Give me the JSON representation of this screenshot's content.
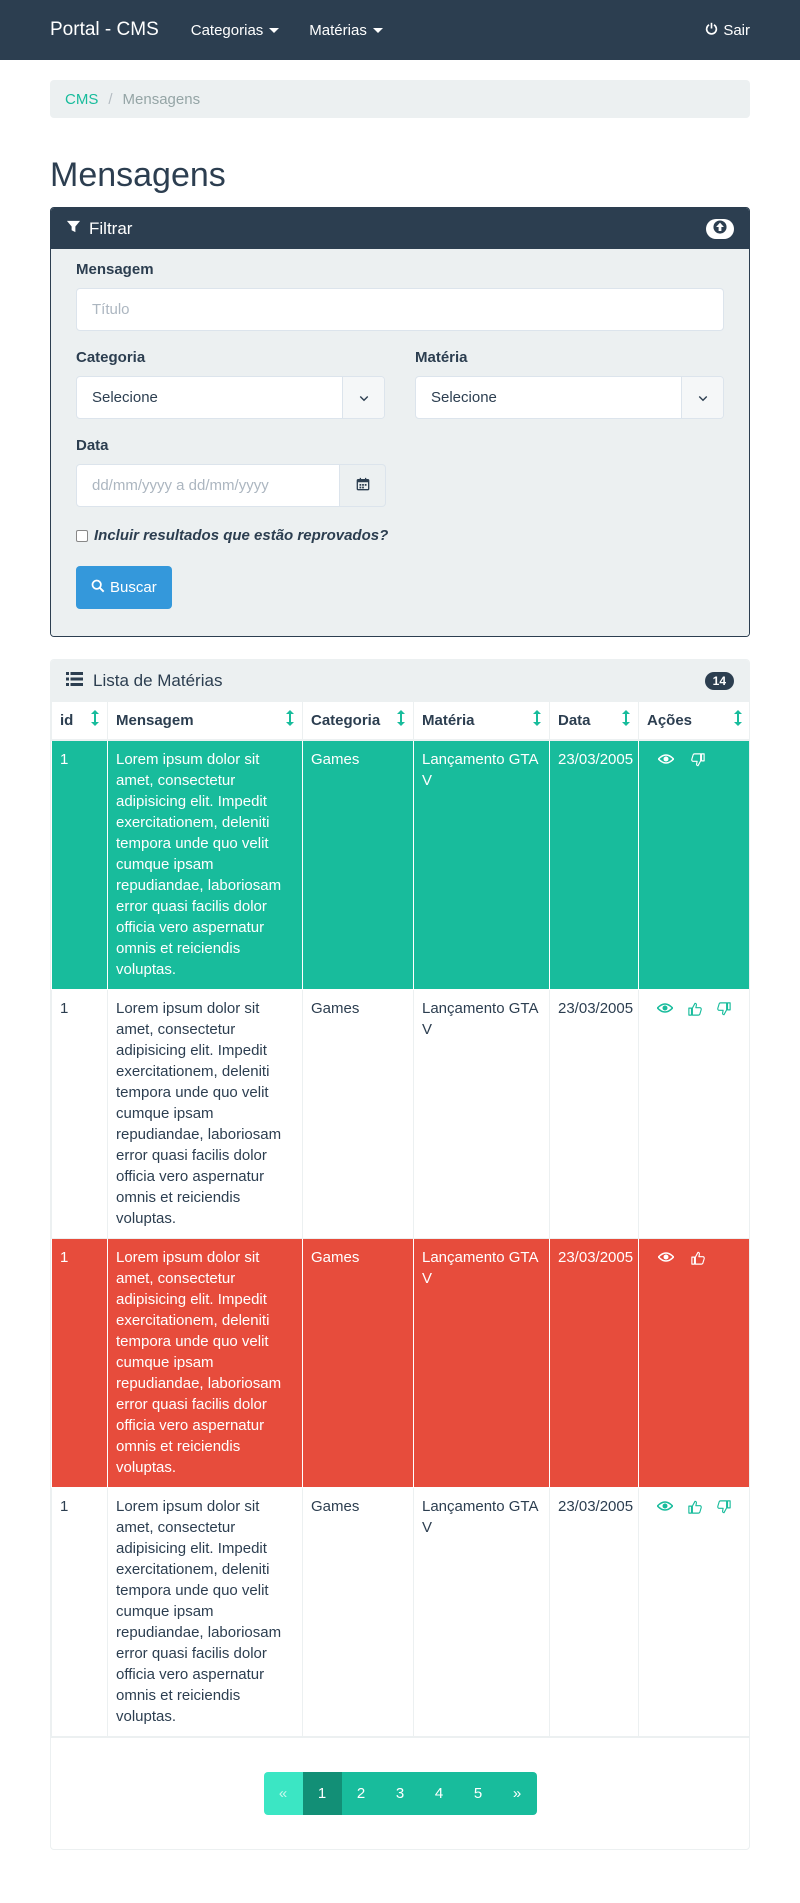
{
  "navbar": {
    "brand": "Portal - CMS",
    "menu": [
      {
        "label": "Categorias"
      },
      {
        "label": "Matérias"
      }
    ],
    "logout_label": "Sair"
  },
  "breadcrumb": {
    "root": "CMS",
    "current": "Mensagens"
  },
  "page_title": "Mensagens",
  "filter": {
    "title": "Filtrar",
    "mensagem_label": "Mensagem",
    "mensagem_placeholder": "Título",
    "categoria_label": "Categoria",
    "categoria_value": "Selecione",
    "materia_label": "Matéria",
    "materia_value": "Selecione",
    "data_label": "Data",
    "data_placeholder": "dd/mm/yyyy a dd/mm/yyyy",
    "reprovados_label": "Incluir resultados que estão reprovados?",
    "search_label": "Buscar"
  },
  "list": {
    "title": "Lista de Matérias",
    "count": "14",
    "columns": [
      "id",
      "Mensagem",
      "Categoria",
      "Matéria",
      "Data",
      "Ações"
    ],
    "rows": [
      {
        "status": "success",
        "id": "1",
        "mensagem": "Lorem ipsum dolor sit amet, consectetur adipisicing elit. Impedit exercitationem, deleniti tempora unde quo velit cumque ipsam repudiandae, laboriosam error quasi facilis dolor officia vero aspernatur omnis et reiciendis voluptas.",
        "categoria": "Games",
        "materia": "Lançamento GTA V",
        "data": "23/03/2005",
        "actions": [
          "eye-icon",
          "thumbs-down-icon"
        ]
      },
      {
        "status": "default",
        "id": "1",
        "mensagem": "Lorem ipsum dolor sit amet, consectetur adipisicing elit. Impedit exercitationem, deleniti tempora unde quo velit cumque ipsam repudiandae, laboriosam error quasi facilis dolor officia vero aspernatur omnis et reiciendis voluptas.",
        "categoria": "Games",
        "materia": "Lançamento GTA V",
        "data": "23/03/2005",
        "actions": [
          "eye-icon",
          "thumbs-up-icon",
          "thumbs-down-icon"
        ]
      },
      {
        "status": "danger",
        "id": "1",
        "mensagem": "Lorem ipsum dolor sit amet, consectetur adipisicing elit. Impedit exercitationem, deleniti tempora unde quo velit cumque ipsam repudiandae, laboriosam error quasi facilis dolor officia vero aspernatur omnis et reiciendis voluptas.",
        "categoria": "Games",
        "materia": "Lançamento GTA V",
        "data": "23/03/2005",
        "actions": [
          "eye-icon",
          "thumbs-up-icon"
        ]
      },
      {
        "status": "default",
        "id": "1",
        "mensagem": "Lorem ipsum dolor sit amet, consectetur adipisicing elit. Impedit exercitationem, deleniti tempora unde quo velit cumque ipsam repudiandae, laboriosam error quasi facilis dolor officia vero aspernatur omnis et reiciendis voluptas.",
        "categoria": "Games",
        "materia": "Lançamento GTA V",
        "data": "23/03/2005",
        "actions": [
          "eye-icon",
          "thumbs-up-icon",
          "thumbs-down-icon"
        ]
      }
    ]
  },
  "pagination": {
    "prev": "«",
    "pages": [
      "1",
      "2",
      "3",
      "4",
      "5"
    ],
    "active": "1",
    "next": "»"
  },
  "colors": {
    "primary": "#2c3e50",
    "success": "#18bc9c",
    "danger": "#e74c3c",
    "info": "#3498db"
  }
}
